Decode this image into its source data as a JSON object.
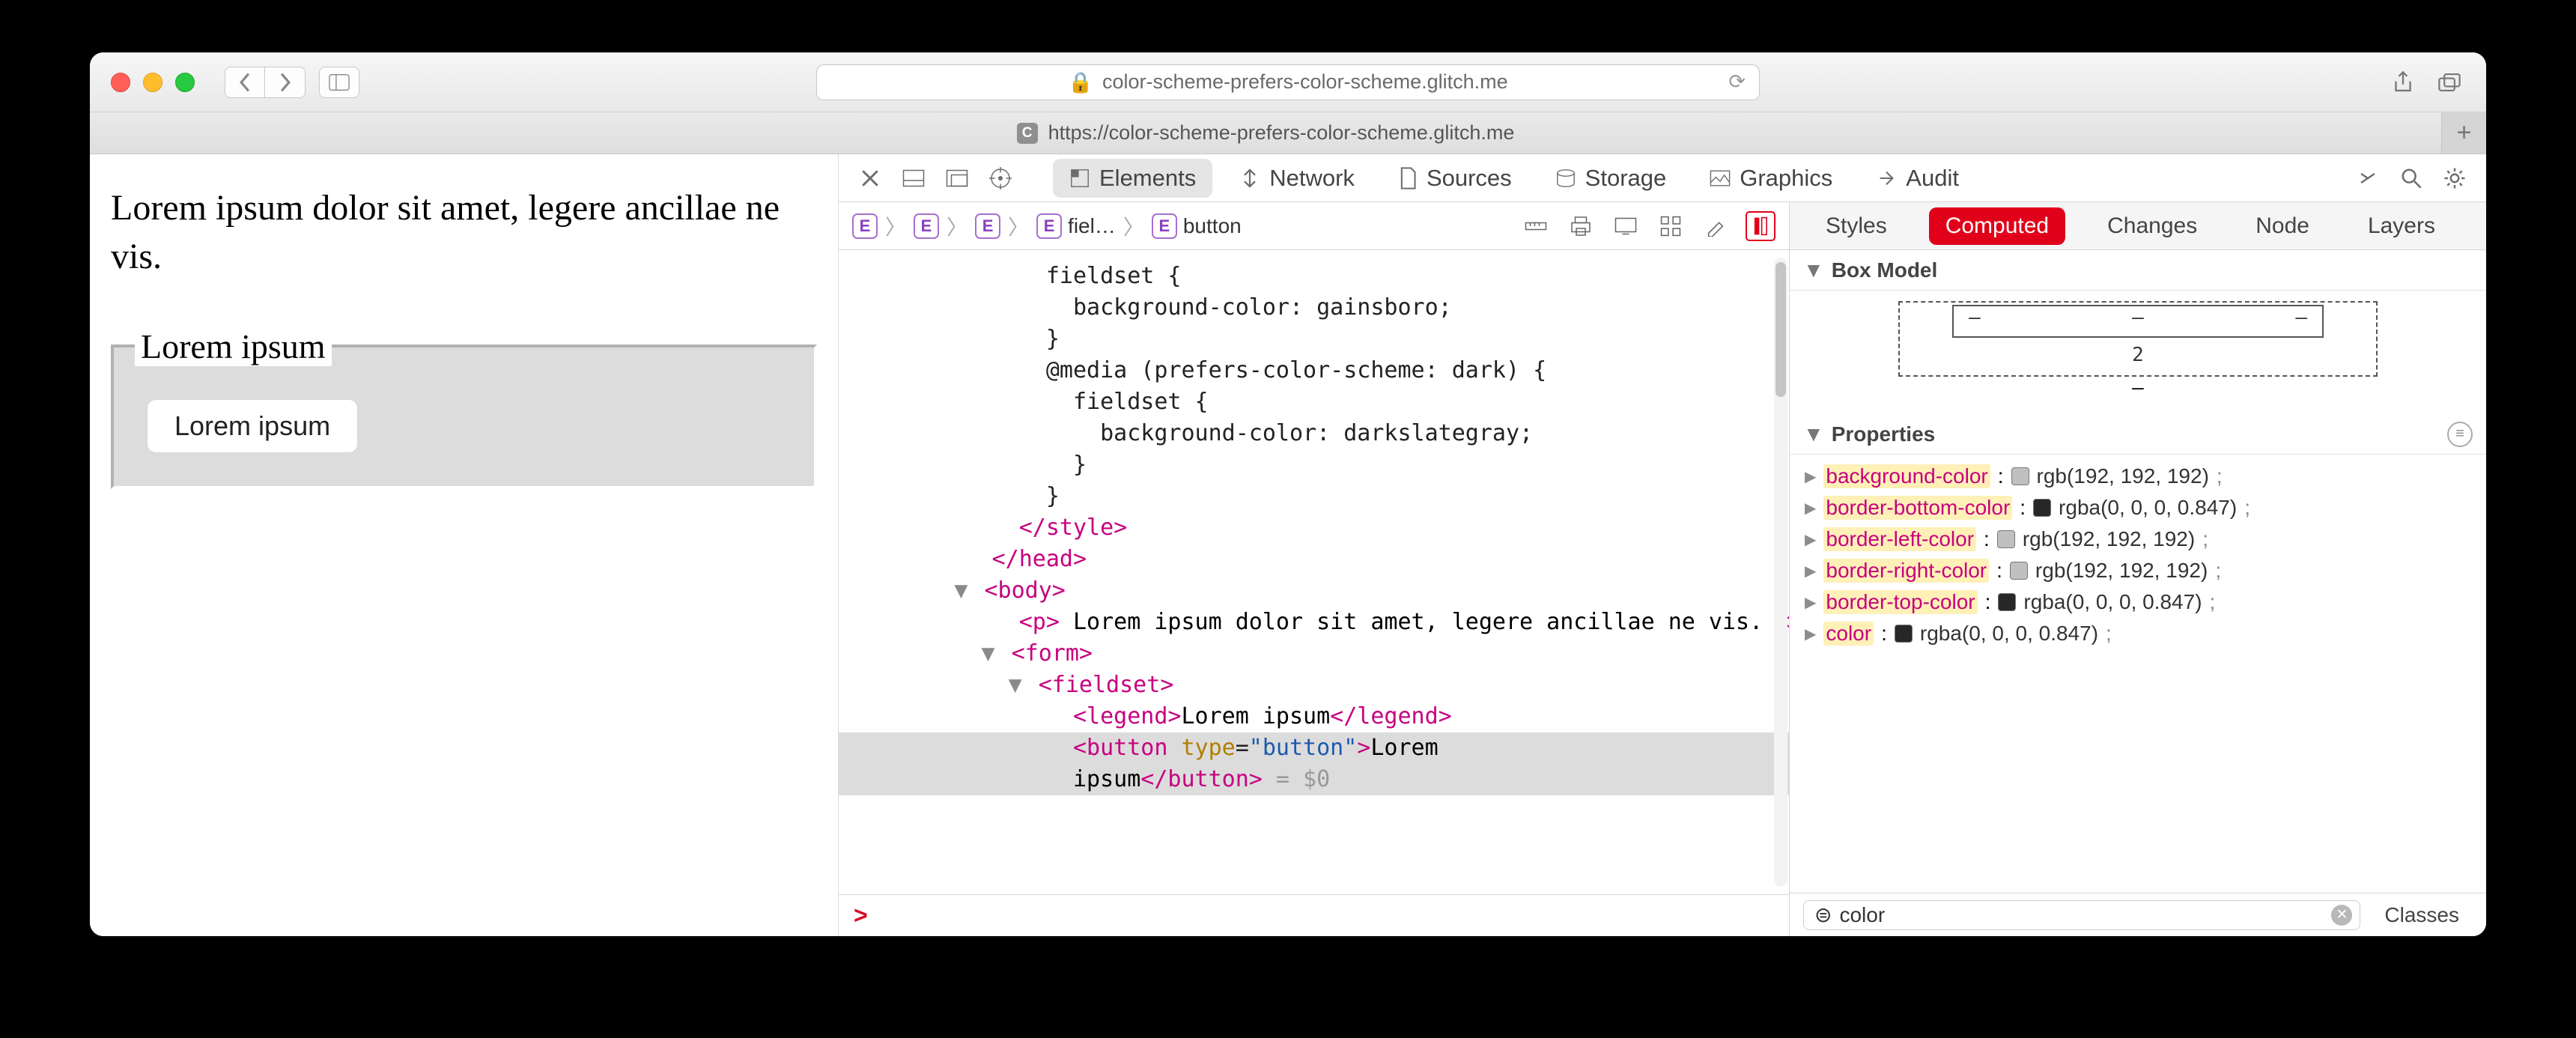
{
  "browser": {
    "url": "color-scheme-prefers-color-scheme.glitch.me",
    "tab_url": "https://color-scheme-prefers-color-scheme.glitch.me",
    "tab_favicon_letter": "C"
  },
  "page": {
    "paragraph": "Lorem ipsum dolor sit amet, legere ancillae ne vis.",
    "legend": "Lorem ipsum",
    "button_label": "Lorem ipsum"
  },
  "devtools": {
    "tabs": {
      "elements": "Elements",
      "network": "Network",
      "sources": "Sources",
      "storage": "Storage",
      "graphics": "Graphics",
      "audit": "Audit"
    },
    "breadcrumbs": [
      "E",
      "E",
      "E",
      "fiel…",
      "button"
    ],
    "code_lines": [
      "              fieldset {",
      "                background-color: gainsboro;",
      "              }",
      "              @media (prefers-color-scheme: dark) {",
      "                fieldset {",
      "                  background-color: darkslategray;",
      "                }",
      "              }"
    ],
    "close_style": "</style>",
    "close_head": "</head>",
    "body": "<body>",
    "p_open": "<p>",
    "p_text": " Lorem ipsum dolor sit amet, legere ancillae ne vis. ",
    "p_close": "</p>",
    "form": "<form>",
    "fieldset": "<fieldset>",
    "legend_open": "<legend>",
    "legend_text": "Lorem ipsum",
    "legend_close": "</legend>",
    "button_open": "<button",
    "button_attr_name": "type",
    "button_attr_val": "\"button\"",
    "button_close_bracket": ">",
    "button_text": "Lorem ipsum",
    "button_close": "</button>",
    "dollar": " = $0",
    "console_prompt": ">"
  },
  "styles_panel": {
    "tabs": {
      "styles": "Styles",
      "computed": "Computed",
      "changes": "Changes",
      "node": "Node",
      "layers": "Layers"
    },
    "box_model_title": "Box Model",
    "box_inner_dashes": [
      "–",
      "–",
      "–"
    ],
    "box_padding_value": "2",
    "box_below_dash": "–",
    "props_title": "Properties",
    "properties": [
      {
        "name": "background-color",
        "swatch": "#c0c0c0",
        "value": "rgb(192, 192, 192)"
      },
      {
        "name": "border-bottom-color",
        "swatch": "#272727",
        "value": "rgba(0, 0, 0, 0.847)"
      },
      {
        "name": "border-left-color",
        "swatch": "#c0c0c0",
        "value": "rgb(192, 192, 192)"
      },
      {
        "name": "border-right-color",
        "swatch": "#c0c0c0",
        "value": "rgb(192, 192, 192)"
      },
      {
        "name": "border-top-color",
        "swatch": "#272727",
        "value": "rgba(0, 0, 0, 0.847)"
      },
      {
        "name": "color",
        "swatch": "#272727",
        "value": "rgba(0, 0, 0, 0.847)"
      }
    ],
    "filter_value": "color",
    "classes_label": "Classes"
  }
}
